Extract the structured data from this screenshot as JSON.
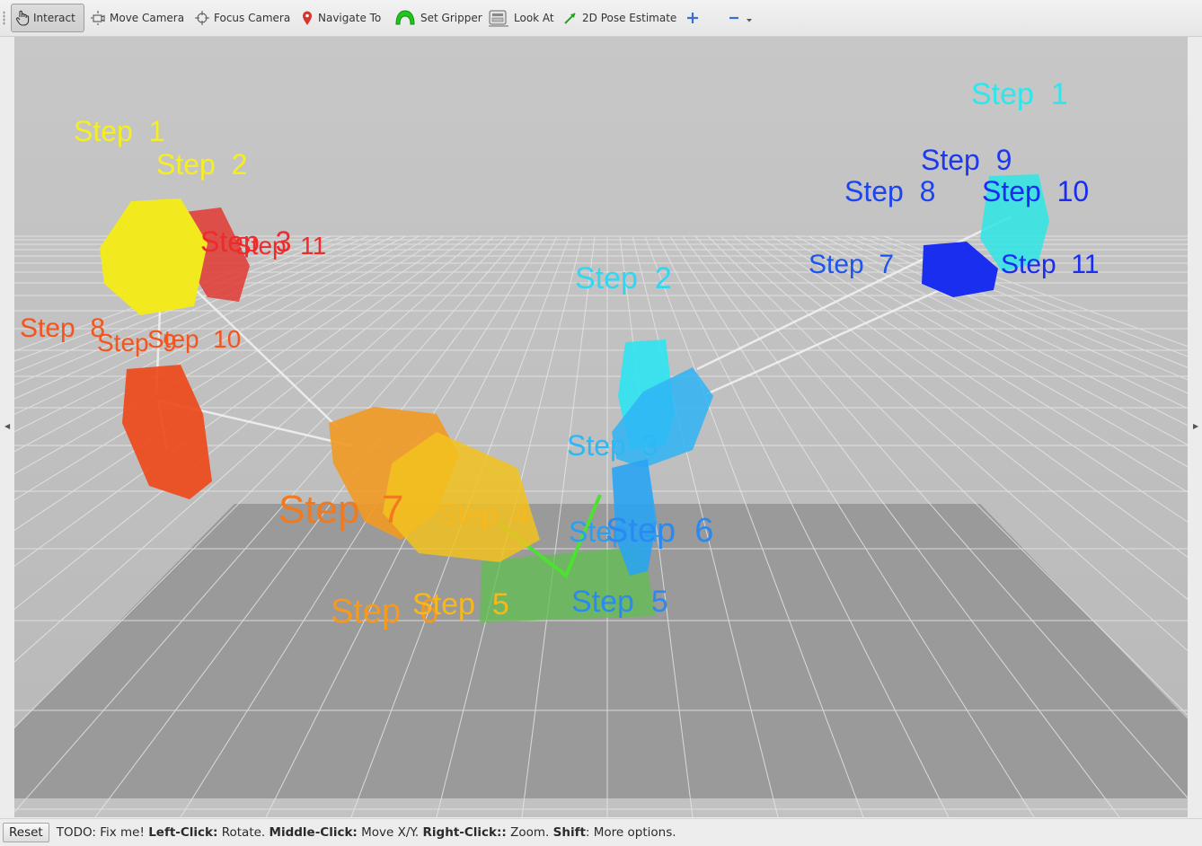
{
  "toolbar": {
    "tools": [
      {
        "label": "Interact"
      },
      {
        "label": "Move Camera"
      },
      {
        "label": "Focus Camera"
      },
      {
        "label": "Navigate To"
      },
      {
        "label": "Set Gripper"
      },
      {
        "label": "Look At"
      },
      {
        "label": "2D Pose Estimate"
      }
    ]
  },
  "viewport": {
    "labels": [
      {
        "text": "Step  1",
        "color": "#f5ee22"
      },
      {
        "text": "Step  2",
        "color": "#f5ee22"
      },
      {
        "text": "Step  3",
        "color": "#ee2b2b"
      },
      {
        "text": "Step  11",
        "color": "#ee2b2b"
      },
      {
        "text": "Step  8",
        "color": "#f2551e"
      },
      {
        "text": "Step  9",
        "color": "#f2551e"
      },
      {
        "text": "Step  10",
        "color": "#f2551e"
      },
      {
        "text": "Step  7",
        "color": "#f27a1e"
      },
      {
        "text": "Step  6",
        "color": "#f59a1e"
      },
      {
        "text": "Step  5",
        "color": "#f7b81e"
      },
      {
        "text": "Step  4",
        "color": "#f7b81e"
      },
      {
        "text": "Step  1",
        "color": "#2de6ee"
      },
      {
        "text": "Step  2",
        "color": "#2ed8f2"
      },
      {
        "text": "Step  3",
        "color": "#2cb8f5"
      },
      {
        "text": "Step  4",
        "color": "#2a9ff2"
      },
      {
        "text": "Step  6",
        "color": "#2a8af0"
      },
      {
        "text": "Step  5",
        "color": "#2a8af0"
      },
      {
        "text": "Step  9",
        "color": "#1c39f0"
      },
      {
        "text": "Step  8",
        "color": "#1c45f0"
      },
      {
        "text": "Step  10",
        "color": "#1a2cf2"
      },
      {
        "text": "Step  7",
        "color": "#1c55f0"
      },
      {
        "text": "Step  11",
        "color": "#1a2cf2"
      }
    ]
  },
  "statusbar": {
    "reset_label": "Reset",
    "text_intro": "TODO: Fix me! ",
    "left_click_key": "Left-Click:",
    "left_click_desc": " Rotate. ",
    "middle_click_key": "Middle-Click:",
    "middle_click_desc": " Move X/Y. ",
    "right_click_key": "Right-Click::",
    "right_click_desc": " Zoom. ",
    "shift_key": "Shift",
    "shift_desc": ": More options."
  }
}
